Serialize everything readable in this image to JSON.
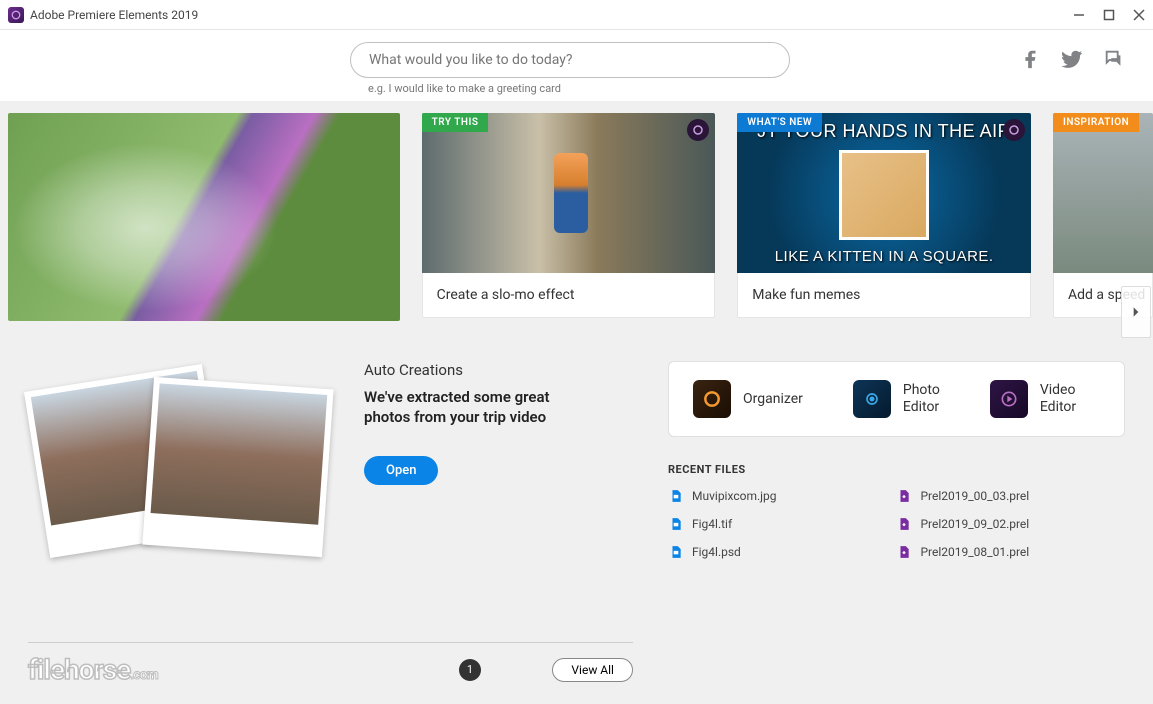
{
  "titlebar": {
    "title": "Adobe Premiere Elements 2019"
  },
  "search": {
    "placeholder": "What would you like to do today?",
    "hint": "e.g. I would like to make a greeting card"
  },
  "cards": {
    "slomo": {
      "badge": "TRY THIS",
      "caption": "Create a slo-mo effect"
    },
    "memes": {
      "badge": "WHAT'S NEW",
      "top": "JT YOUR HANDS IN THE AIR",
      "bottom": "LIKE A KITTEN IN A SQUARE.",
      "caption": "Make fun memes"
    },
    "inspir": {
      "badge": "INSPIRATION",
      "caption": "Add a speed"
    }
  },
  "auto": {
    "heading": "Auto Creations",
    "sub": "We've extracted some great photos from your trip video",
    "open": "Open"
  },
  "editors": {
    "organizer": "Organizer",
    "photo": "Photo\nEditor",
    "video": "Video\nEditor"
  },
  "recent": {
    "heading": "RECENT FILES",
    "left": [
      "Muvipixcom.jpg",
      "Fig4l.tif",
      "Fig4l.psd"
    ],
    "right": [
      "Prel2019_00_03.prel",
      "Prel2019_09_02.prel",
      "Prel2019_08_01.prel"
    ]
  },
  "footer": {
    "logo": "filehorse",
    "logo_suffix": ".com",
    "page": "1",
    "viewall": "View All"
  }
}
